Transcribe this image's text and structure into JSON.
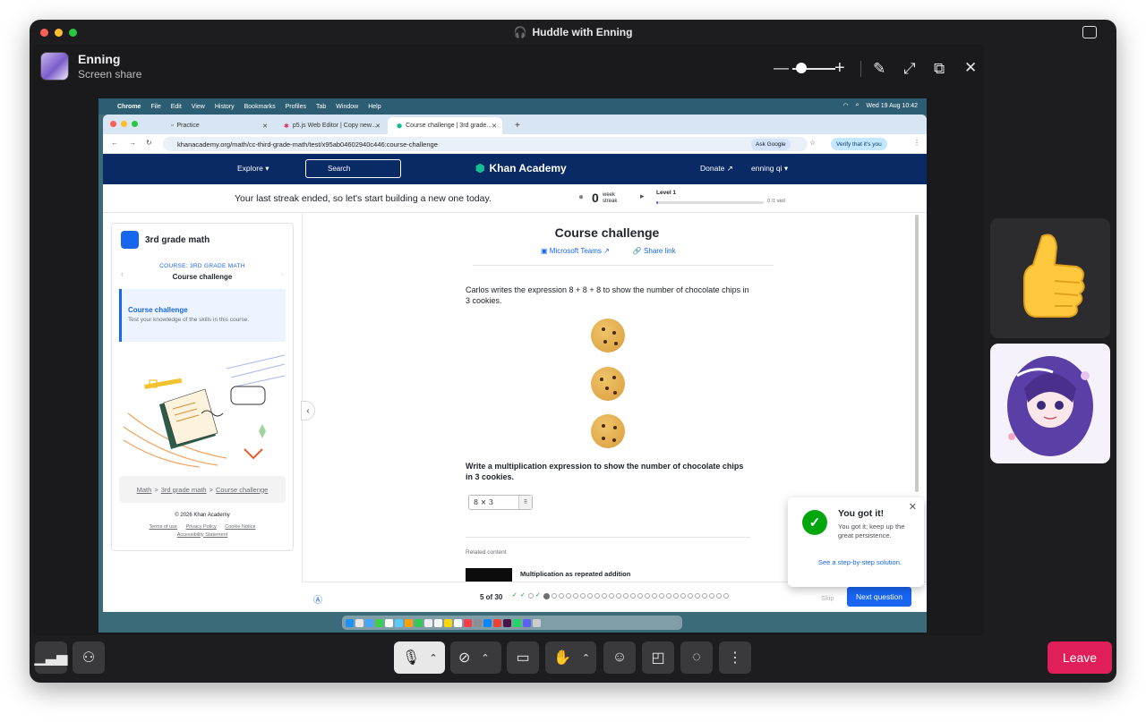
{
  "window": {
    "title": "Huddle with Enning"
  },
  "presenter": {
    "name": "Enning",
    "subtitle": "Screen share"
  },
  "mac_menu": {
    "app": "Chrome",
    "items": [
      "File",
      "Edit",
      "View",
      "History",
      "Bookmarks",
      "Profiles",
      "Tab",
      "Window",
      "Help"
    ],
    "clock": "Wed 19 Aug 10:42"
  },
  "browser": {
    "tabs": [
      {
        "label": "Practice"
      },
      {
        "label": "p5.js Web Editor | Copy new..."
      },
      {
        "label": "Course challenge | 3rd grade..."
      }
    ],
    "new_tab": "+",
    "url": "khanacademy.org/math/cc-third-grade-math/test/x95ab04602940c446:course-challenge",
    "ask_google": "Ask Google",
    "verify": "Verify that it's you"
  },
  "ka_nav": {
    "explore": "Explore",
    "search": "Search",
    "logo": "Khan Academy",
    "donate": "Donate",
    "user": "enning qi"
  },
  "streak": {
    "message": "Your last streak ended, so let's start building a new one today.",
    "count": "0",
    "week_label": "week streak",
    "level": "Level 1",
    "skills": "0 /1 skill",
    "level_progress": 0.02
  },
  "sidebar": {
    "course_title": "3rd grade math",
    "course_label": "COURSE: 3RD GRADE MATH",
    "course_sub": "Course challenge",
    "card_title": "Course challenge",
    "card_desc": "Test your knowledge of the skills in this course.",
    "breadcrumb": [
      "Math",
      "3rd grade math",
      "Course challenge"
    ],
    "copyright": "© 2026 Khan Academy",
    "links": [
      "Terms of use",
      "Privacy Policy",
      "Cookie Notice",
      "Accessibility Statement"
    ]
  },
  "main": {
    "title": "Course challenge",
    "share_teams": "Microsoft Teams",
    "share_link": "Share link",
    "question": "Carlos writes the expression 8 + 8 + 8 to show the number of chocolate chips in 3 cookies.",
    "prompt": "Write a multiplication expression to show the number of chocolate chips in 3 cookies.",
    "answer": "8 × 3",
    "related_label": "Related content",
    "related_title": "Multiplication as repeated addition"
  },
  "progress": {
    "text": "5 of 30",
    "skip": "Skip",
    "next": "Next question"
  },
  "toast": {
    "title": "You got it!",
    "body": "You got it; keep up the great persistence.",
    "link": "See a step-by-step solution."
  },
  "footer": {
    "leave": "Leave"
  },
  "colors": {
    "ka_navy": "#0a2a66",
    "ka_blue": "#1865f2",
    "success": "#00a60e",
    "leave": "#e01e5a"
  }
}
